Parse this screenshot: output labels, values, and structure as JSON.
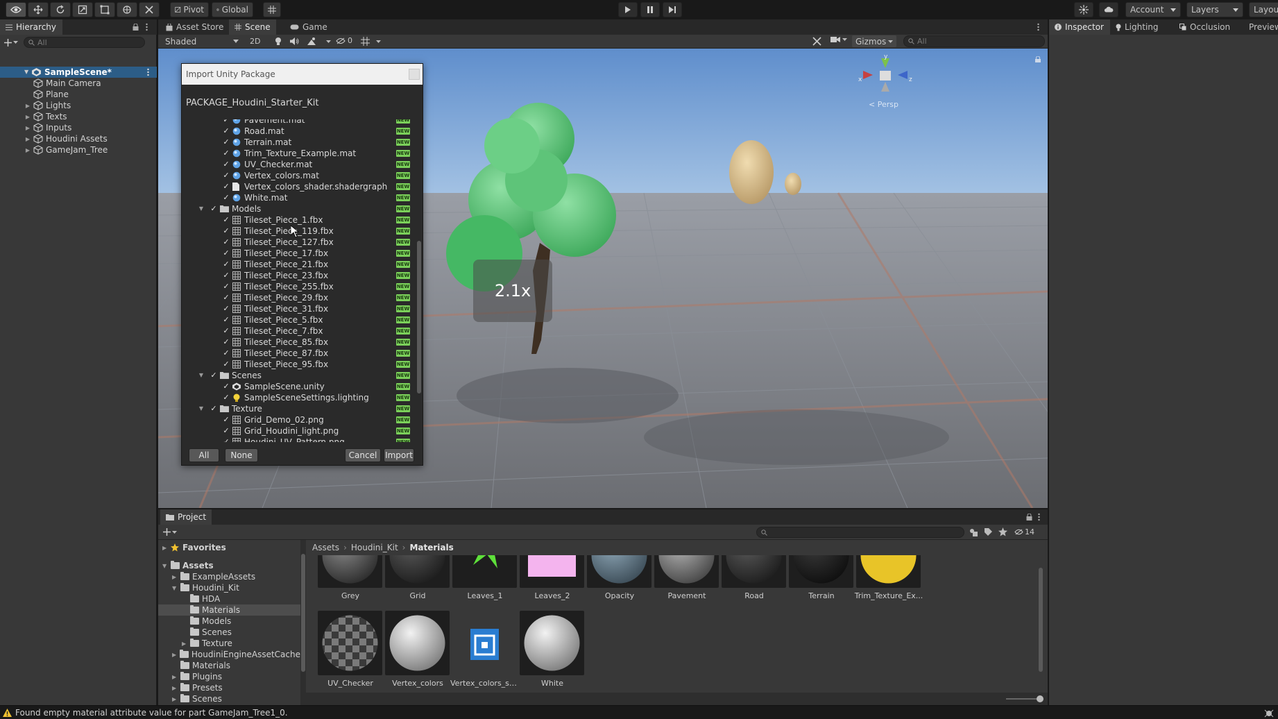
{
  "toolbar": {
    "pivot_label": "Pivot",
    "global_label": "Global",
    "account_label": "Account",
    "layers_label": "Layers",
    "layout_label": "Layou"
  },
  "hierarchy": {
    "tab_label": "Hierarchy",
    "search_placeholder": "All",
    "scene_name": "SampleScene*",
    "items": [
      {
        "label": "Main Camera",
        "has_children": false
      },
      {
        "label": "Plane",
        "has_children": false
      },
      {
        "label": "Lights",
        "has_children": true
      },
      {
        "label": "Texts",
        "has_children": true
      },
      {
        "label": "Inputs",
        "has_children": true
      },
      {
        "label": "Houdini Assets",
        "has_children": true
      },
      {
        "label": "GameJam_Tree",
        "has_children": true
      }
    ]
  },
  "scene_tabs": {
    "asset_store": "Asset Store",
    "scene": "Scene",
    "game": "Game"
  },
  "scene_toolbar": {
    "shading_mode": "Shaded",
    "two_d": "2D",
    "hidden_count": "0",
    "gizmos": "Gizmos",
    "search_placeholder": "All"
  },
  "scene": {
    "zoom_overlay": "2.1x",
    "gizmo_x": "x",
    "gizmo_y": "y",
    "gizmo_z": "z",
    "persp_label": "< Persp"
  },
  "import_dialog": {
    "window_title": "Import Unity Package",
    "package_name": "PACKAGE_Houdini_Starter_Kit",
    "new_badge": "NEW",
    "rows": [
      {
        "label": "Pavement.mat",
        "indent": 2,
        "icon": "material"
      },
      {
        "label": "Road.mat",
        "indent": 2,
        "icon": "material"
      },
      {
        "label": "Terrain.mat",
        "indent": 2,
        "icon": "material"
      },
      {
        "label": "Trim_Texture_Example.mat",
        "indent": 2,
        "icon": "material"
      },
      {
        "label": "UV_Checker.mat",
        "indent": 2,
        "icon": "material"
      },
      {
        "label": "Vertex_colors.mat",
        "indent": 2,
        "icon": "material"
      },
      {
        "label": "Vertex_colors_shader.shadergraph",
        "indent": 2,
        "icon": "file"
      },
      {
        "label": "White.mat",
        "indent": 2,
        "icon": "material"
      },
      {
        "label": "Models",
        "indent": 1,
        "icon": "folder"
      },
      {
        "label": "Tileset_Piece_1.fbx",
        "indent": 2,
        "icon": "mesh"
      },
      {
        "label": "Tileset_Piece_119.fbx",
        "indent": 2,
        "icon": "mesh"
      },
      {
        "label": "Tileset_Piece_127.fbx",
        "indent": 2,
        "icon": "mesh"
      },
      {
        "label": "Tileset_Piece_17.fbx",
        "indent": 2,
        "icon": "mesh"
      },
      {
        "label": "Tileset_Piece_21.fbx",
        "indent": 2,
        "icon": "mesh"
      },
      {
        "label": "Tileset_Piece_23.fbx",
        "indent": 2,
        "icon": "mesh"
      },
      {
        "label": "Tileset_Piece_255.fbx",
        "indent": 2,
        "icon": "mesh"
      },
      {
        "label": "Tileset_Piece_29.fbx",
        "indent": 2,
        "icon": "mesh"
      },
      {
        "label": "Tileset_Piece_31.fbx",
        "indent": 2,
        "icon": "mesh"
      },
      {
        "label": "Tileset_Piece_5.fbx",
        "indent": 2,
        "icon": "mesh"
      },
      {
        "label": "Tileset_Piece_7.fbx",
        "indent": 2,
        "icon": "mesh"
      },
      {
        "label": "Tileset_Piece_85.fbx",
        "indent": 2,
        "icon": "mesh"
      },
      {
        "label": "Tileset_Piece_87.fbx",
        "indent": 2,
        "icon": "mesh"
      },
      {
        "label": "Tileset_Piece_95.fbx",
        "indent": 2,
        "icon": "mesh"
      },
      {
        "label": "Scenes",
        "indent": 1,
        "icon": "folder"
      },
      {
        "label": "SampleScene.unity",
        "indent": 2,
        "icon": "unity"
      },
      {
        "label": "SampleSceneSettings.lighting",
        "indent": 2,
        "icon": "light"
      },
      {
        "label": "Texture",
        "indent": 1,
        "icon": "folder"
      },
      {
        "label": "Grid_Demo_02.png",
        "indent": 2,
        "icon": "image"
      },
      {
        "label": "Grid_Houdini_light.png",
        "indent": 2,
        "icon": "image"
      },
      {
        "label": "Houdini_UV_Pattern.png",
        "indent": 2,
        "icon": "image"
      }
    ],
    "btn_all": "All",
    "btn_none": "None",
    "btn_cancel": "Cancel",
    "btn_import": "Import"
  },
  "inspector": {
    "tabs": [
      "Inspector",
      "Lighting",
      "Occlusion",
      "Preview"
    ]
  },
  "project": {
    "tab_label": "Project",
    "hidden_count": "14",
    "breadcrumb": [
      "Assets",
      "Houdini_Kit",
      "Materials"
    ],
    "favorites_label": "Favorites",
    "tree": [
      {
        "label": "Assets",
        "indent": 0,
        "expanded": true,
        "bold": true
      },
      {
        "label": "ExampleAssets",
        "indent": 1,
        "arrow": true
      },
      {
        "label": "Houdini_Kit",
        "indent": 1,
        "expanded": true
      },
      {
        "label": "HDA",
        "indent": 2
      },
      {
        "label": "Materials",
        "indent": 2,
        "selected": true
      },
      {
        "label": "Models",
        "indent": 2
      },
      {
        "label": "Scenes",
        "indent": 2
      },
      {
        "label": "Texture",
        "indent": 2,
        "arrow": true
      },
      {
        "label": "HoudiniEngineAssetCache",
        "indent": 1,
        "arrow": true
      },
      {
        "label": "Materials",
        "indent": 1
      },
      {
        "label": "Plugins",
        "indent": 1,
        "arrow": true
      },
      {
        "label": "Presets",
        "indent": 1,
        "arrow": true
      },
      {
        "label": "Scenes",
        "indent": 1,
        "arrow": true
      }
    ],
    "assets_row1": [
      {
        "label": "Grey",
        "kind": "sphere-dark"
      },
      {
        "label": "Grid",
        "kind": "sphere-darker"
      },
      {
        "label": "Leaves_1",
        "kind": "leaves"
      },
      {
        "label": "Leaves_2",
        "kind": "pink"
      },
      {
        "label": "Opacity",
        "kind": "sphere-blue"
      },
      {
        "label": "Pavement",
        "kind": "sphere-grey"
      },
      {
        "label": "Road",
        "kind": "sphere-darker"
      },
      {
        "label": "Terrain",
        "kind": "sphere-black"
      },
      {
        "label": "Trim_Texture_Ex...",
        "kind": "sphere-redyellow"
      }
    ],
    "assets_row2": [
      {
        "label": "UV_Checker",
        "kind": "checker"
      },
      {
        "label": "Vertex_colors",
        "kind": "sphere-white"
      },
      {
        "label": "Vertex_colors_sh...",
        "kind": "shader"
      },
      {
        "label": "White",
        "kind": "sphere-white"
      }
    ]
  },
  "status": {
    "message": "Found empty material attribute value for part GameJam_Tree1_0."
  },
  "colors": {
    "accent_new": "#7bd05a",
    "selection": "#2c5d87",
    "warning": "#f2c230"
  }
}
